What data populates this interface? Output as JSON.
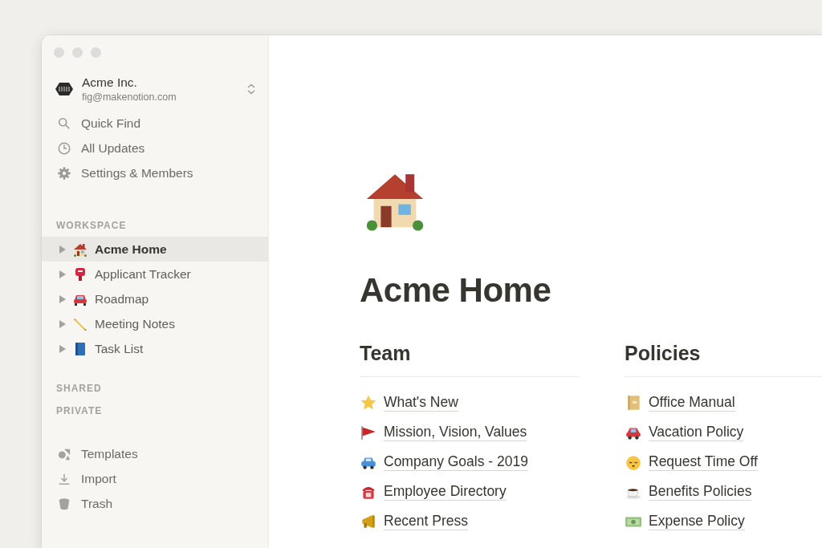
{
  "sidebar": {
    "workspace": {
      "name": "Acme Inc.",
      "email": "fig@makenotion.com"
    },
    "nav": [
      "Quick Find",
      "All Updates",
      "Settings & Members"
    ],
    "sections": [
      {
        "label": "WORKSPACE",
        "pages": [
          {
            "title": "Acme Home",
            "selected": true,
            "expanded": false
          },
          {
            "title": "Applicant Tracker",
            "selected": false,
            "expanded": false
          },
          {
            "title": "Roadmap",
            "selected": false,
            "expanded": false
          },
          {
            "title": "Meeting Notes",
            "selected": false,
            "expanded": false
          },
          {
            "title": "Task List",
            "selected": false,
            "expanded": false
          }
        ]
      },
      {
        "label": "SHARED"
      },
      {
        "label": "PRIVATE"
      }
    ],
    "footer": [
      "Templates",
      "Import",
      "Trash"
    ]
  },
  "page": {
    "title": "Acme Home",
    "columns": [
      {
        "heading": "Team",
        "links": [
          "What's New",
          "Mission, Vision, Values",
          "Company Goals - 2019",
          "Employee Directory",
          "Recent Press"
        ]
      },
      {
        "heading": "Policies",
        "links": [
          "Office Manual",
          "Vacation Policy",
          "Request Time Off",
          "Benefits Policies",
          "Expense Policy"
        ]
      }
    ]
  }
}
